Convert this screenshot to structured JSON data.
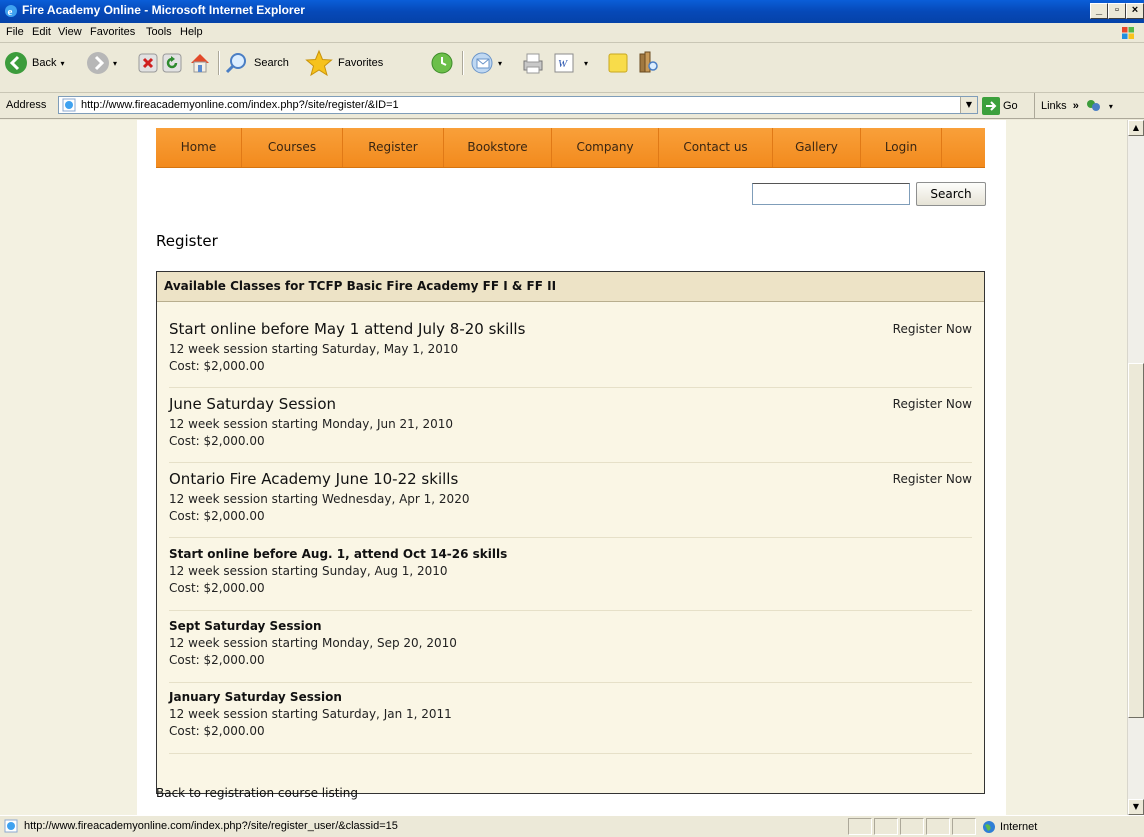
{
  "window": {
    "title": "Fire Academy Online - Microsoft Internet Explorer",
    "min": "_",
    "max": "&#x25A1;",
    "close": "×"
  },
  "menu": [
    "File",
    "Edit",
    "View",
    "Favorites",
    "Tools",
    "Help"
  ],
  "toolbar": {
    "back": "Back",
    "search": "Search",
    "favorites": "Favorites"
  },
  "address": {
    "label": "Address",
    "url": "http://www.fireacademyonline.com/index.php?/site/register/&ID=1",
    "go": "Go",
    "links": "Links"
  },
  "nav": [
    "Home",
    "Courses",
    "Register",
    "Bookstore",
    "Company",
    "Contact us",
    "Gallery",
    "Login"
  ],
  "search": {
    "value": "",
    "button": "Search"
  },
  "page": {
    "heading": "Register",
    "panel_title": "Available Classes for TCFP Basic Fire Academy FF I & FF II",
    "classes": [
      {
        "title": "Start online before May 1 attend July 8-20 skills",
        "session": "12 week session starting Saturday, May 1, 2010",
        "cost": "Cost: $2,000.00",
        "action": "Register Now"
      },
      {
        "title": "June Saturday Session",
        "session": "12 week session starting Monday, Jun 21, 2010",
        "cost": "Cost: $2,000.00",
        "action": "Register Now"
      },
      {
        "title": "Ontario Fire Academy June 10-22 skills",
        "session": "12 week session starting Wednesday, Apr 1, 2020",
        "cost": "Cost: $2,000.00",
        "action": "Register Now"
      },
      {
        "title": "Start online before Aug. 1, attend Oct 14-26 skills",
        "session": "12 week session starting Sunday, Aug 1, 2010",
        "cost": "Cost: $2,000.00"
      },
      {
        "title": "Sept Saturday Session",
        "session": "12 week session starting Monday, Sep 20, 2010",
        "cost": "Cost: $2,000.00"
      },
      {
        "title": "January Saturday Session",
        "session": "12 week session starting Saturday, Jan 1, 2011",
        "cost": "Cost: $2,000.00"
      }
    ],
    "back_link": "Back to registration course listing"
  },
  "status": {
    "text": "http://www.fireacademyonline.com/index.php?/site/register_user/&classid=15",
    "zone": "Internet"
  },
  "colors": {
    "nav_orange": "#F28A1D",
    "panel_bg": "#FAF6E5",
    "panel_header": "#EDE3C6",
    "title_blue": "#0A5ED8"
  }
}
